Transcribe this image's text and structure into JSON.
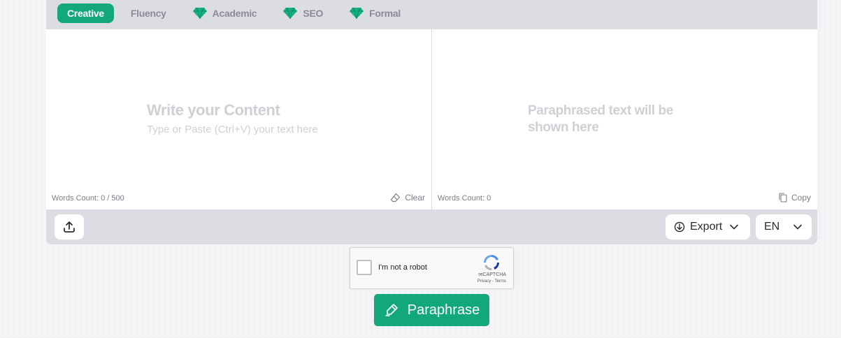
{
  "modes": [
    {
      "label": "Creative",
      "active": true,
      "premium": false
    },
    {
      "label": "Fluency",
      "active": false,
      "premium": false
    },
    {
      "label": "Academic",
      "active": false,
      "premium": true
    },
    {
      "label": "SEO",
      "active": false,
      "premium": true
    },
    {
      "label": "Formal",
      "active": false,
      "premium": true
    }
  ],
  "input": {
    "title": "Write your Content",
    "subtitle": "Type or Paste (Ctrl+V) your text here",
    "words_count": "Words Count: 0 / 500",
    "clear_label": "Clear"
  },
  "output": {
    "placeholder_line1": "Paraphrased text will be",
    "placeholder_line2": "shown here",
    "words_count": "Words Count: 0",
    "copy_label": "Copy"
  },
  "toolbar": {
    "export_label": "Export",
    "language": "EN"
  },
  "captcha": {
    "label": "I'm not a robot",
    "brand": "reCAPTCHA",
    "links": "Privacy - Terms"
  },
  "paraphrase_label": "Paraphrase",
  "colors": {
    "accent": "#13a879",
    "premium_gem": "#19b27f"
  },
  "icons": {
    "upload": "upload-icon",
    "eraser": "eraser-icon",
    "copy": "copy-icon",
    "export": "download-icon",
    "chevron": "chevron-down-icon",
    "paraphrase": "pen-icon",
    "gem": "gem-icon"
  }
}
